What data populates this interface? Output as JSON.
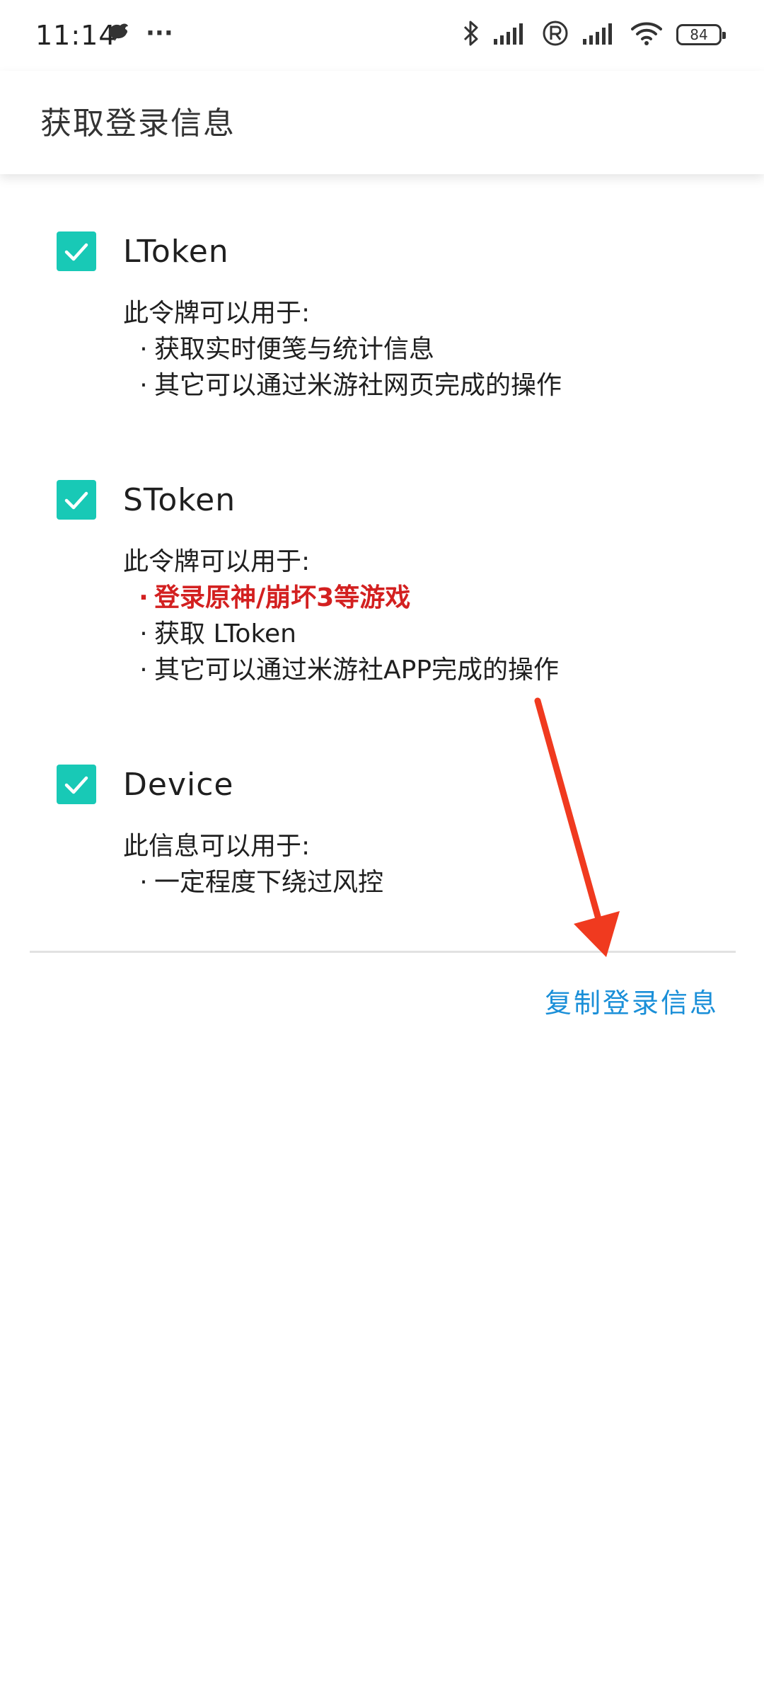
{
  "status_bar": {
    "time": "11:14",
    "more_dots": "···",
    "battery": "84"
  },
  "app_bar": {
    "title": "获取登录信息"
  },
  "options": [
    {
      "title": "LToken",
      "checked": true,
      "intro": "此令牌可以用于:",
      "bullets": [
        {
          "text": "获取实时便笺与统计信息",
          "emphasis": false
        },
        {
          "text": "其它可以通过米游社网页完成的操作",
          "emphasis": false
        }
      ]
    },
    {
      "title": "SToken",
      "checked": true,
      "intro": "此令牌可以用于:",
      "bullets": [
        {
          "text": "登录原神/崩坏3等游戏",
          "emphasis": true
        },
        {
          "text": "获取 LToken",
          "emphasis": false
        },
        {
          "text": "其它可以通过米游社APP完成的操作",
          "emphasis": false
        }
      ]
    },
    {
      "title": "Device",
      "checked": true,
      "intro": "此信息可以用于:",
      "bullets": [
        {
          "text": "一定程度下绕过风控",
          "emphasis": false
        }
      ]
    }
  ],
  "bullet_mark": "·",
  "actions": {
    "copy_label": "复制登录信息"
  },
  "colors": {
    "checkbox": "#18c9b6",
    "emphasis": "#d32020",
    "action": "#1a8fd8",
    "annotation_arrow": "#f03a1f"
  },
  "icons": {
    "status_left": [
      "bird-notification-icon"
    ],
    "status_right": [
      "bluetooth-icon",
      "signal-icon",
      "roaming-r-icon",
      "signal-icon",
      "wifi-icon",
      "battery-icon"
    ],
    "checkbox": "checkmark-icon"
  }
}
